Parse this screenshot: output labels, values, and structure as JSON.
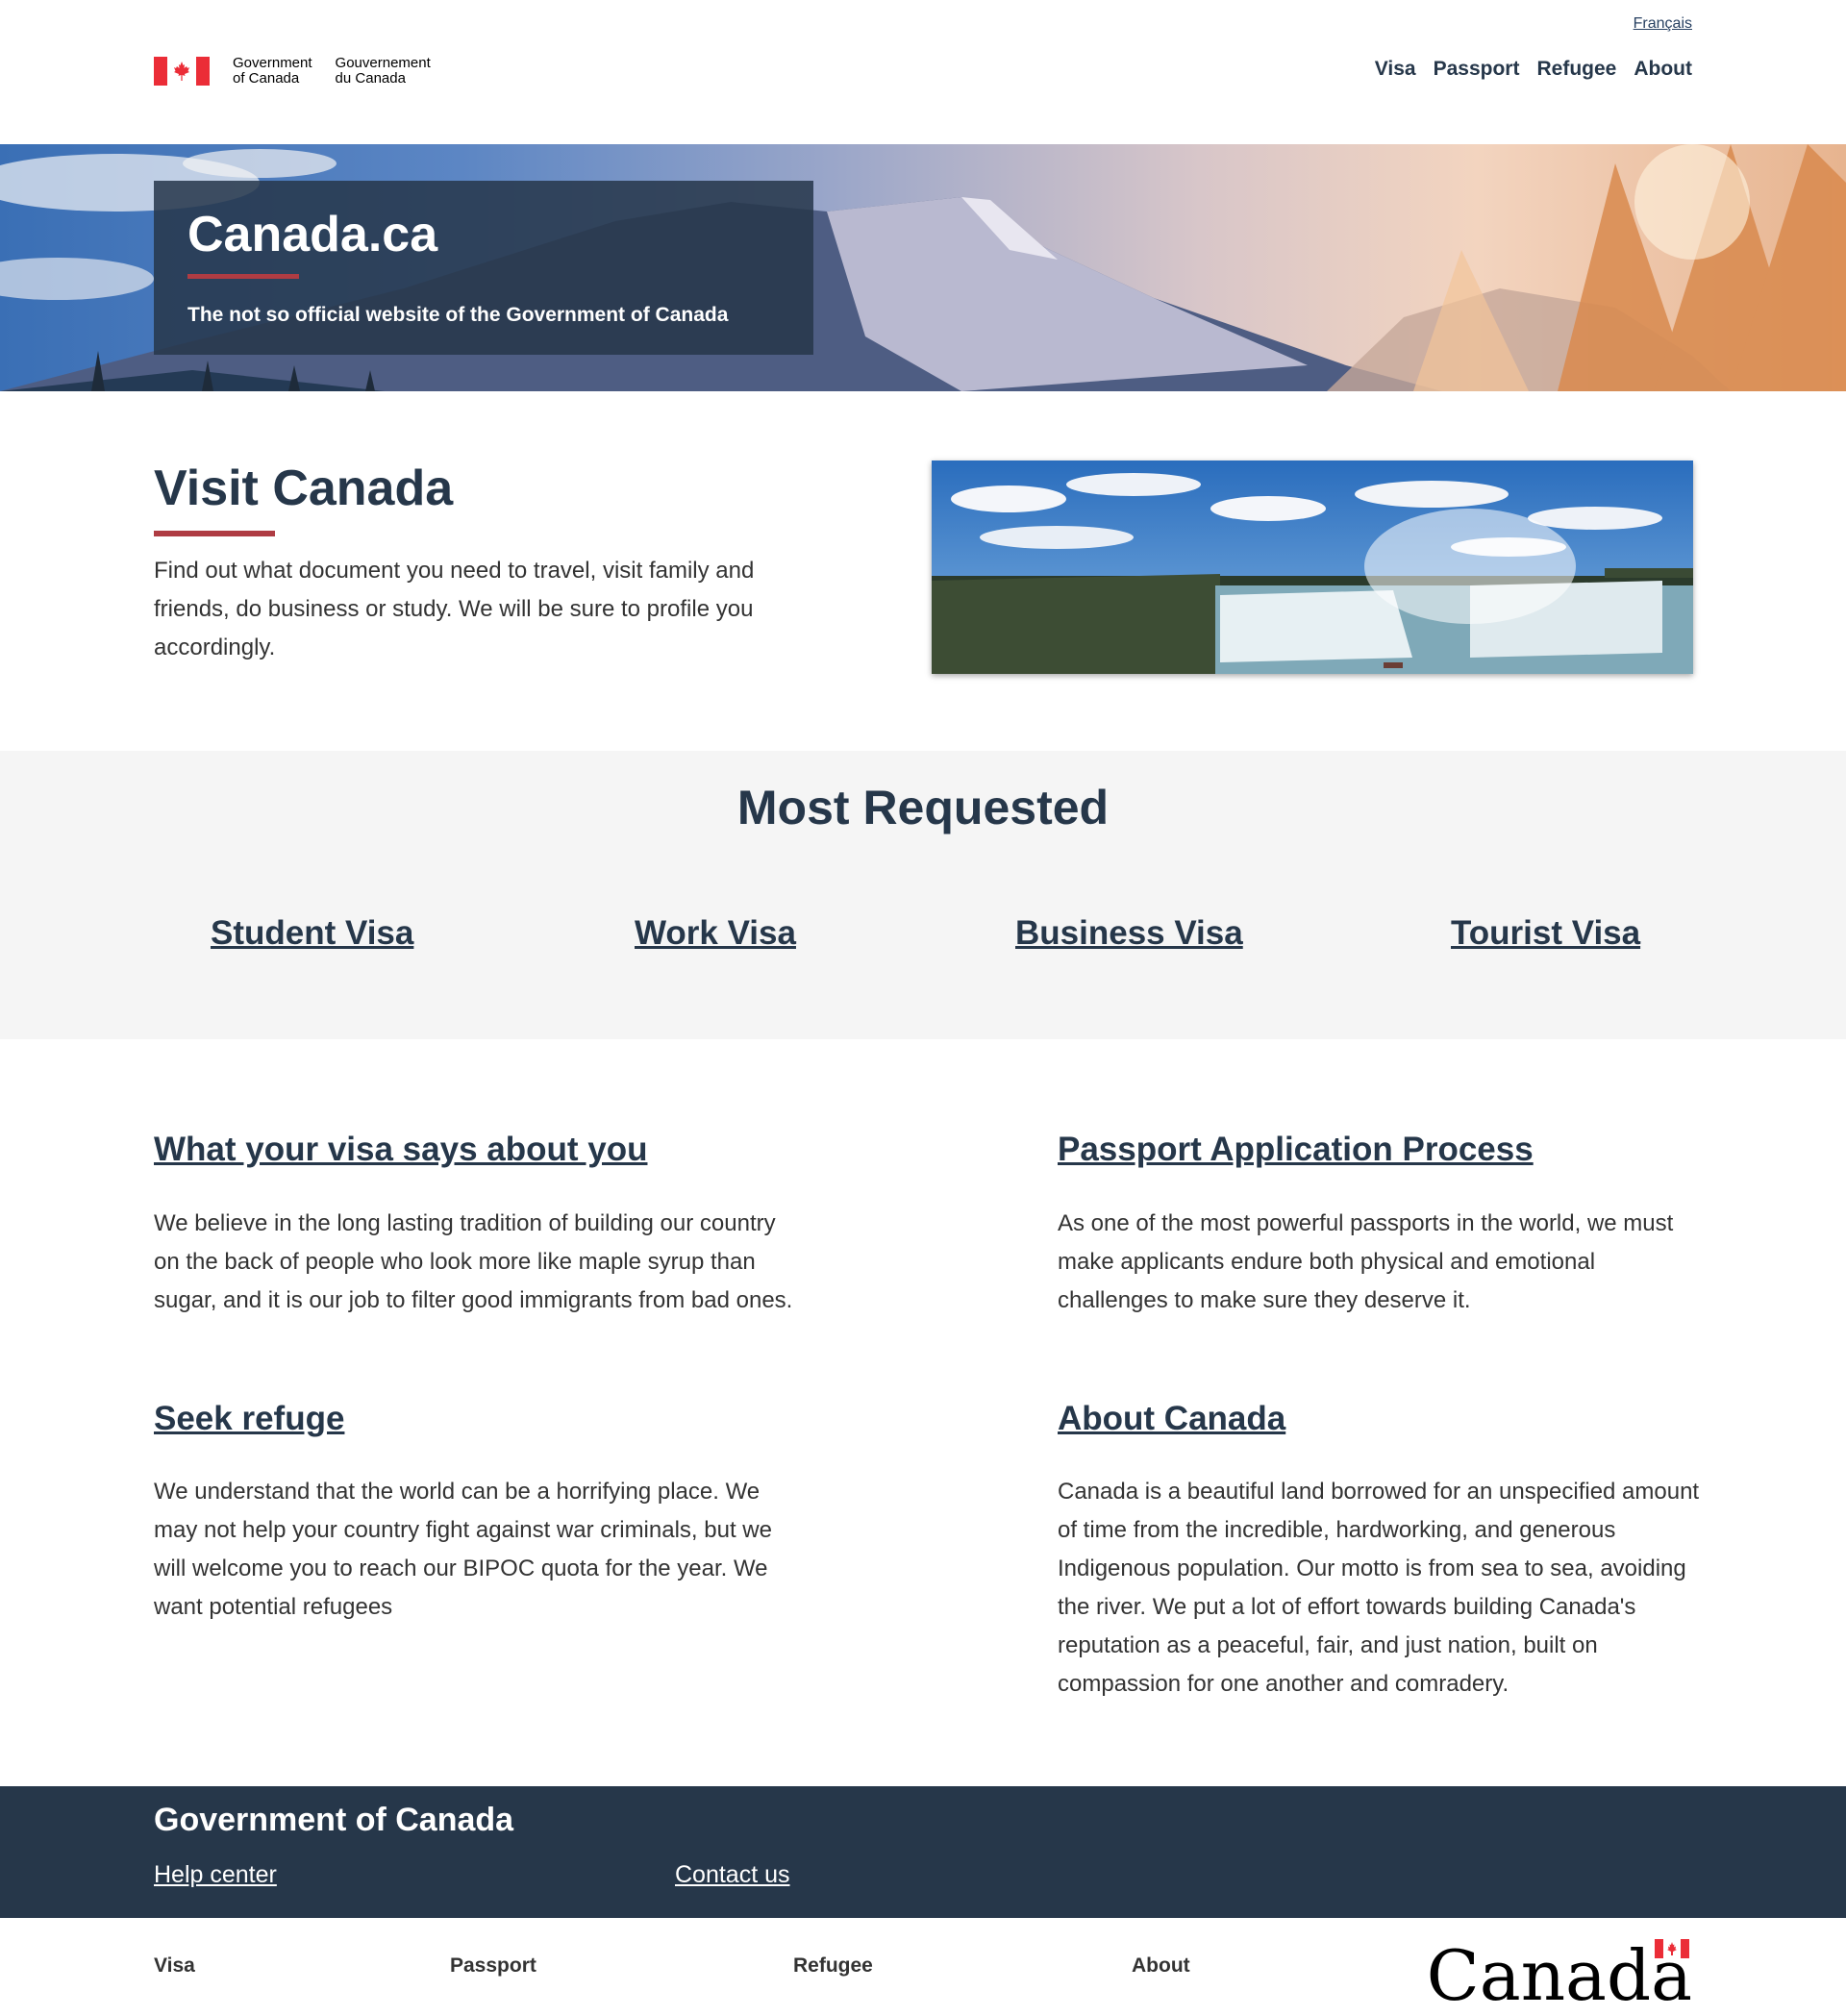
{
  "header": {
    "language_link": "Français",
    "signature_en": [
      "Government",
      "of Canada"
    ],
    "signature_fr": [
      "Gouvernement",
      "du Canada"
    ],
    "nav": [
      "Visa",
      "Passport",
      "Refugee",
      "About"
    ]
  },
  "hero": {
    "title": "Canada.ca",
    "subtitle": "The not so official website of the Government of Canada"
  },
  "visit": {
    "title": "Visit Canada",
    "text": "Find out what document you need to travel, visit family and friends, do business or study. We will be sure to profile you accordingly."
  },
  "most_requested": {
    "title": "Most Requested",
    "links": [
      "Student Visa",
      "Work Visa",
      "Business Visa",
      "Tourist Visa"
    ]
  },
  "articles": [
    {
      "title": "What your visa says about you",
      "text": "We believe in the long lasting tradition of building our country on the back of people who look more like maple syrup than sugar, and it is our job to filter good immigrants from bad ones."
    },
    {
      "title": "Passport Application Process",
      "text": "As one of the most powerful passports in the world, we must make applicants endure both physical and emotional challenges to make sure they deserve it."
    },
    {
      "title": "Seek refuge",
      "text": "We understand that the world can be a horrifying place. We may not help your country fight against war criminals, but we will welcome you to reach our BIPOC quota for the year. We want potential refugees"
    },
    {
      "title": "About Canada",
      "text": "Canada is a beautiful land borrowed for an unspecified amount of time from the incredible, hardworking, and generous Indigenous population. Our motto is from sea to sea, avoiding the river. We put a lot of effort towards building Canada's reputation as a peaceful, fair, and just nation, built on compassion for one another and comradery."
    }
  ],
  "footer": {
    "title": "Government of Canada",
    "links": [
      "Help center",
      "Contact us"
    ],
    "nav": [
      "Visa",
      "Passport",
      "Refugee",
      "About"
    ],
    "wordmark": "Canada"
  },
  "colors": {
    "accent_red": "#af3c43",
    "navy": "#26374a",
    "flag_red": "#eb2d37"
  }
}
